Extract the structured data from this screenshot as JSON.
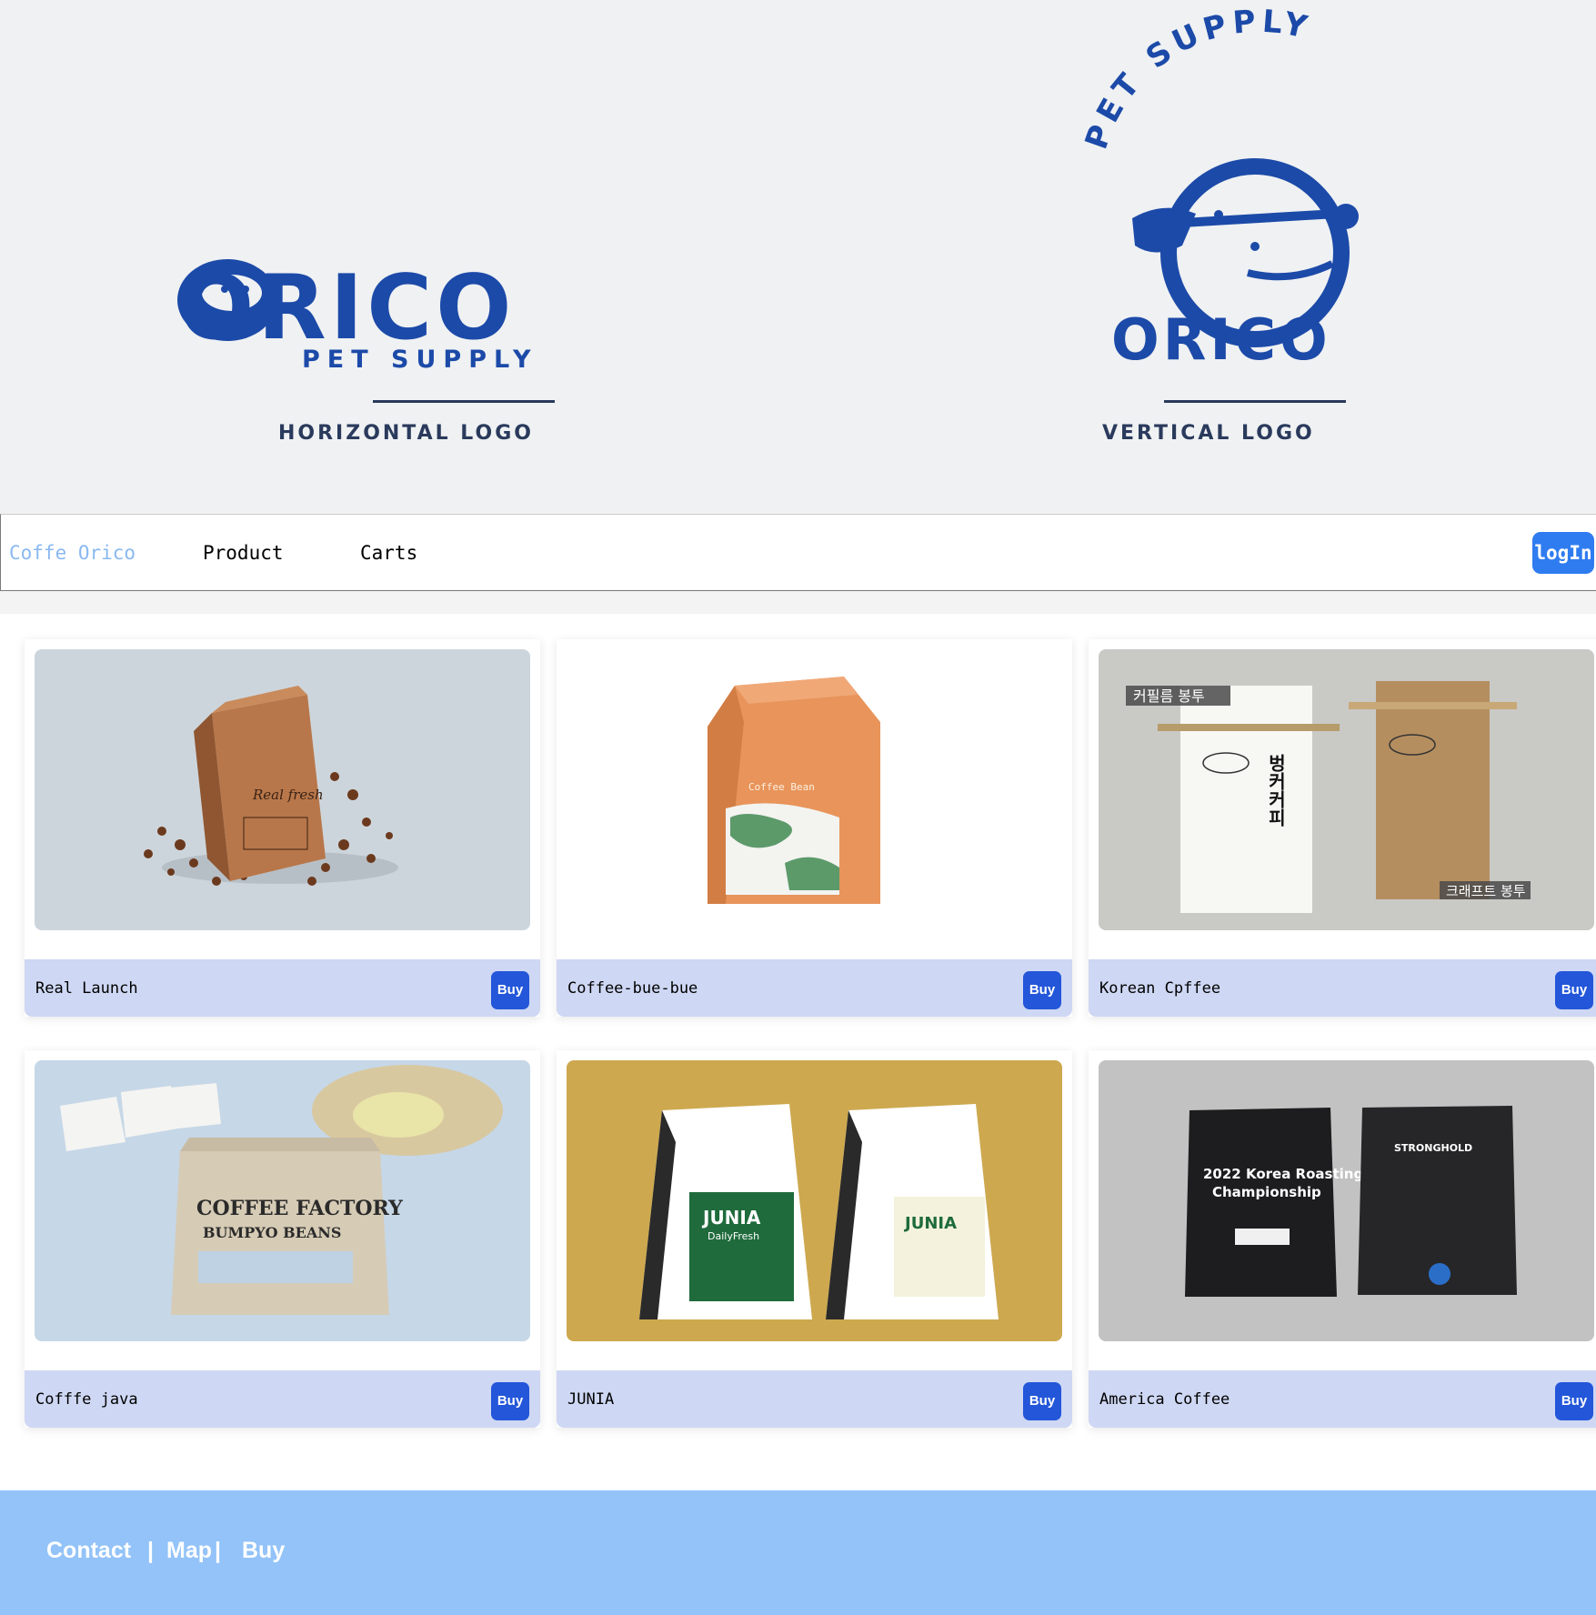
{
  "hero": {
    "horizontal": {
      "wordmark": "ORICO",
      "tagline": "PET SUPPLY",
      "caption": "HORIZONTAL LOGO"
    },
    "vertical": {
      "arc_text": "PET SUPPLY",
      "wordmark": "ORICO",
      "caption": "VERTICAL LOGO"
    },
    "brand_color": "#1c4aa8"
  },
  "nav": {
    "brand": "Coffe Orico",
    "links": [
      "Product",
      "Carts"
    ],
    "login": "logIn"
  },
  "products": [
    {
      "name": "Real Launch",
      "buy": "Buy"
    },
    {
      "name": "Coffee-bue-bue",
      "buy": "Buy"
    },
    {
      "name": "Korean Cpffee",
      "buy": "Buy"
    },
    {
      "name": "Cofffe java",
      "buy": "Buy"
    },
    {
      "name": "JUNIA",
      "buy": "Buy"
    },
    {
      "name": "America Coffee",
      "buy": "Buy"
    }
  ],
  "product_images": {
    "p1": {
      "bag_text": "Real fresh"
    },
    "p2": {
      "bag_text": "Coffee Bean"
    },
    "p3": {
      "tag_left": "커필름 봉투",
      "tag_right": "크래프트 봉투",
      "bag_text": "벙커커피"
    },
    "p4": {
      "bag_text": "COFFEE FACTORY",
      "bag_sub": "BUMPYO BEANS"
    },
    "p5": {
      "bag_text": "JUNIA",
      "bag_sub": "DailyFresh"
    },
    "p6": {
      "bag_text": "2022 Korea Roasting Championship",
      "bag_sub": "STRONGHOLD"
    }
  },
  "footer": {
    "links": [
      "Contact",
      "Map",
      "Buy"
    ],
    "separator": "|"
  },
  "colors": {
    "accent": "#2f7cf0",
    "buy": "#2356d9",
    "card_bar": "#ced7f3",
    "footer": "#93c3f8",
    "brand_text": "#8ab9f1"
  }
}
